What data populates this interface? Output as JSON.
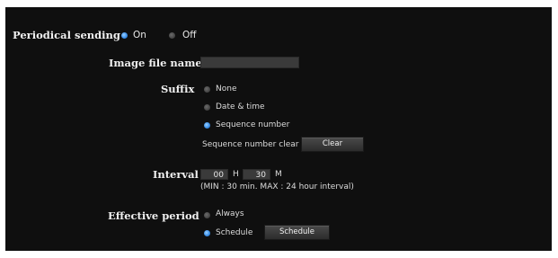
{
  "periodical_sending": {
    "label": "Periodical sending",
    "options": [
      {
        "label": "On",
        "selected": true
      },
      {
        "label": "Off",
        "selected": false
      }
    ]
  },
  "image_file_name": {
    "label": "Image file name",
    "value": ""
  },
  "suffix": {
    "label": "Suffix",
    "options": [
      {
        "label": "None",
        "selected": false
      },
      {
        "label": "Date & time",
        "selected": false
      },
      {
        "label": "Sequence number",
        "selected": true
      }
    ],
    "clear_label": "Sequence number clear",
    "clear_button": "Clear"
  },
  "interval": {
    "label": "Interval",
    "hours": "00",
    "hours_unit": "H",
    "minutes": "30",
    "minutes_unit": "M",
    "note": "(MIN : 30 min. MAX : 24 hour interval)"
  },
  "effective_period": {
    "label": "Effective period",
    "options": [
      {
        "label": "Always",
        "selected": false
      },
      {
        "label": "Schedule",
        "selected": true
      }
    ],
    "schedule_button": "Schedule"
  },
  "colors": {
    "background": "#0f0f0f",
    "radio_on": "#3b8fe8",
    "radio_off": "#474747",
    "field": "#3a3a3a"
  }
}
